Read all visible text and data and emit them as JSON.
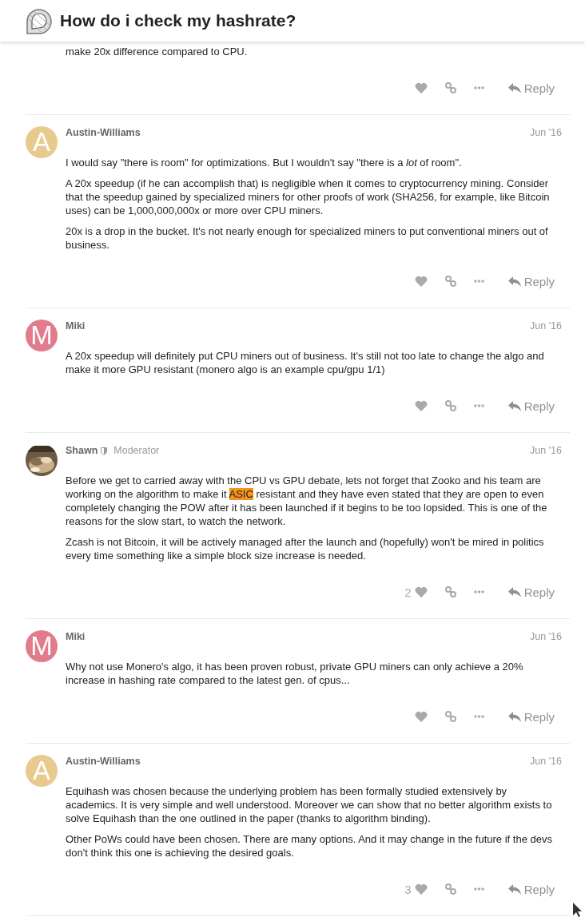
{
  "header": {
    "title": "How do i check my hashrate?"
  },
  "posts": [
    {
      "paragraphs": [
        [
          {
            "text": "make 20x difference compared to CPU.",
            "highlight": false
          }
        ]
      ],
      "actions": {
        "reply": "Reply"
      }
    },
    {
      "author": "Austin-Williams",
      "avatar": {
        "kind": "letter",
        "letter": "A",
        "color": "#e8c98e"
      },
      "date": "Jun '16",
      "paragraphs": [
        [
          {
            "text": "I would say \"there is room\" for optimizations. But I wouldn't say \"there is a *lot* of room\".",
            "highlight": false
          }
        ],
        [
          {
            "text": "A 20x speedup (if he can accomplish that) is negligible when it comes to cryptocurrency mining. Consider that the speedup gained by specialized miners for other proofs of work (SHA256, for example, like Bitcoin uses) can be 1,000,000,000x or more over CPU miners.",
            "highlight": false
          }
        ],
        [
          {
            "text": "20x is a drop in the bucket. It's not nearly enough for specialized miners to put conventional miners out of business.",
            "highlight": false
          }
        ]
      ],
      "actions": {
        "reply": "Reply"
      }
    },
    {
      "author": "Miki",
      "avatar": {
        "kind": "letter",
        "letter": "M",
        "color": "#e27b8c"
      },
      "date": "Jun '16",
      "paragraphs": [
        [
          {
            "text": "A 20x speedup will definitely put CPU miners out of business. It's still not too late to change the algo and make it more GPU resistant (monero algo is an example cpu/gpu 1/1)",
            "highlight": false
          }
        ]
      ],
      "actions": {
        "reply": "Reply"
      }
    },
    {
      "author": "Shawn",
      "moderator": true,
      "role": "Moderator",
      "avatar": {
        "kind": "picture"
      },
      "date": "Jun '16",
      "paragraphs": [
        [
          {
            "text": "Before we get to carried away with the CPU vs GPU debate, lets not forget that Zooko and his team are working on the algorithm to make it ",
            "highlight": false
          },
          {
            "text": "ASIC",
            "highlight": true
          },
          {
            "text": " resistant and they have even stated that they are open to even completely changing the POW after it has been launched if it begins to be too lopsided. This is one of the reasons for the slow start, to watch the network.",
            "highlight": false
          }
        ],
        [
          {
            "text": "Zcash is not Bitcoin, it will be actively managed after the launch and (hopefully) won't be mired in politics every time something like a simple block size increase is needed.",
            "highlight": false
          }
        ]
      ],
      "actions": {
        "likes": "2",
        "reply": "Reply"
      }
    },
    {
      "author": "Miki",
      "avatar": {
        "kind": "letter",
        "letter": "M",
        "color": "#e27b8c"
      },
      "date": "Jun '16",
      "paragraphs": [
        [
          {
            "text": "Why not use Monero's algo, it has been proven robust, private GPU miners can only achieve a 20% increase in hashing rate compared to the latest gen. of cpus...",
            "highlight": false
          }
        ]
      ],
      "actions": {
        "reply": "Reply"
      }
    },
    {
      "author": "Austin-Williams",
      "avatar": {
        "kind": "letter",
        "letter": "A",
        "color": "#e8c98e"
      },
      "date": "Jun '16",
      "paragraphs": [
        [
          {
            "text": "Equihash was chosen because the underlying problem has been formally studied extensively by academics. It is very simple and well understood. Moreover we can show that no better algorithm exists to solve Equihash than the one outlined in the paper (thanks to algorithm binding).",
            "highlight": false
          }
        ],
        [
          {
            "text": "Other PoWs could have been chosen. There are many options. And it may change in the future if the devs don't think this one is achieving the desired goals.",
            "highlight": false
          }
        ]
      ],
      "actions": {
        "likes": "3",
        "reply": "Reply"
      }
    }
  ]
}
